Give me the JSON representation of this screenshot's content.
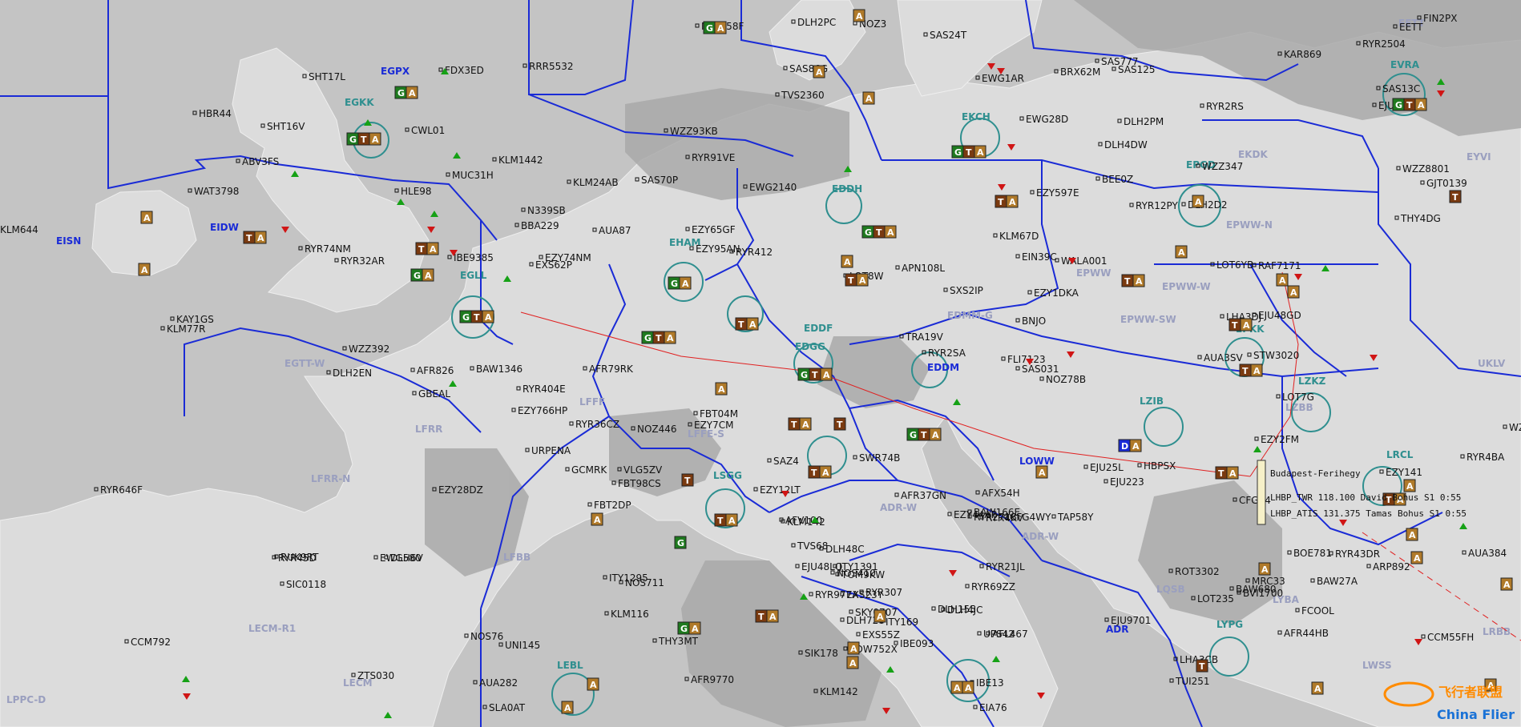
{
  "colors": {
    "sea": "#c4c4c4",
    "land": "#dcdcdc",
    "land_dark": "#a9a9a9",
    "boundary": "#1a2bd6",
    "sector": "#9a9fbf",
    "airport_ring": "#2f8f8f",
    "airport_label": "#2f8f8f",
    "fir_label": "#1a2bd6",
    "badge_green": "#1f7a1f",
    "badge_brown": "#7a3a10",
    "badge_tan": "#b07a2a",
    "arrow_up": "#16a116",
    "arrow_down": "#d01515",
    "route": "#e02020"
  },
  "fir_labels": [
    {
      "id": "EISN",
      "text": "EISN"
    },
    {
      "id": "ADR",
      "text": "ADR"
    }
  ],
  "sectors": [
    {
      "id": "EISN-text",
      "text": "EISN"
    },
    {
      "id": "egtt-w",
      "text": "EGTT-W"
    },
    {
      "id": "lfrr",
      "text": "LFRR"
    },
    {
      "id": "lfrr-n",
      "text": "LFRR-N"
    },
    {
      "id": "lfbb",
      "text": "LFBB"
    },
    {
      "id": "lecm-r1",
      "text": "LECM-R1"
    },
    {
      "id": "lecm",
      "text": "LECM"
    },
    {
      "id": "lppc-d",
      "text": "LPPC-D"
    },
    {
      "id": "lffe-n",
      "text": "LFFE-N"
    },
    {
      "id": "lffe-s",
      "text": "LFFE-S"
    },
    {
      "id": "lfff",
      "text": "LFFF"
    },
    {
      "id": "edmm-g",
      "text": "EDMM-G"
    },
    {
      "id": "epww-sw",
      "text": "EPWW-SW"
    },
    {
      "id": "epww-w",
      "text": "EPWW-W"
    },
    {
      "id": "epww-n",
      "text": "EPWW-N"
    },
    {
      "id": "epww",
      "text": "EPWW"
    },
    {
      "id": "adr-w",
      "text": "ADR-W"
    },
    {
      "id": "lqsb",
      "text": "LQSB"
    },
    {
      "id": "lyba",
      "text": "LYBA"
    },
    {
      "id": "ukbv",
      "text": "UKLV"
    },
    {
      "id": "lrbb",
      "text": "LRBB"
    },
    {
      "id": "lwss",
      "text": "LWSS"
    },
    {
      "id": "lzbb",
      "text": "LZBB"
    },
    {
      "id": "lobb",
      "text": "LOBB"
    },
    {
      "id": "ldpp",
      "text": "LDPP"
    },
    {
      "id": "edww-w",
      "text": "EDWW-W"
    },
    {
      "id": "edvv-e",
      "text": "EDVV-E"
    },
    {
      "id": "eett",
      "text": "EETT"
    },
    {
      "id": "ebbu",
      "text": "EBBU"
    },
    {
      "id": "ekdk",
      "text": "EKDK"
    },
    {
      "id": "eynk",
      "text": "EYVI"
    }
  ],
  "airports": [
    {
      "id": "egpx",
      "text": "EGPX"
    },
    {
      "id": "egkk",
      "text": "EGKK"
    },
    {
      "id": "egll",
      "text": "EGLL"
    },
    {
      "id": "eidw",
      "text": "EIDW"
    },
    {
      "id": "eham",
      "text": "EHAM"
    },
    {
      "id": "eddf",
      "text": "EDDF"
    },
    {
      "id": "eddm",
      "text": "EDDM"
    },
    {
      "id": "edgg",
      "text": "EDGG"
    },
    {
      "id": "lzib",
      "text": "LZIB"
    },
    {
      "id": "lowv",
      "text": "LOWW"
    },
    {
      "id": "epkk",
      "text": "EPKK"
    },
    {
      "id": "epgd",
      "text": "EPGD"
    },
    {
      "id": "lzkz",
      "text": "LZKZ"
    },
    {
      "id": "lrcl",
      "text": "LRCL"
    },
    {
      "id": "lssg",
      "text": "LSGG"
    },
    {
      "id": "lebl",
      "text": "LEBL"
    },
    {
      "id": "lypg",
      "text": "LYPG"
    },
    {
      "id": "evra",
      "text": "EVRA"
    },
    {
      "id": "ekch",
      "text": "EKCH"
    },
    {
      "id": "edwh",
      "text": "EDDH"
    }
  ],
  "callsigns": [
    "NPT358F",
    "DLH2PC",
    "NOZ3",
    "SAS24T",
    "FIN2PX",
    "KAR869",
    "RYR2504",
    "EETT",
    "FDX3ED",
    "RRR5532",
    "SHT17L",
    "HBR44",
    "SHT16V",
    "CWL01",
    "TVS2360",
    "SAS86G",
    "SAS125",
    "SAS777",
    "BRX62M",
    "EWG1AR",
    "EJU47PM",
    "SAS13C",
    "RYR2RS",
    "ABV3FS",
    "KLM1442",
    "WZZ93KB",
    "RYR91VE",
    "DLH2PM",
    "EWG28D",
    "MUC31H",
    "KLM24AB",
    "SAS70P",
    "DLH4DW",
    "WZZ347",
    "WZZ8801",
    "GJT0139",
    "KLM644",
    "WAT3798",
    "HLE98",
    "N339SB",
    "BEE0Z",
    "EWG2140",
    "EZY597E",
    "RYR12PY",
    "DLH2D2",
    "THY4DG",
    "BBA229",
    "AUA87",
    "EZY65GF",
    "RYR74NM",
    "RYR32AR",
    "IBE9385",
    "EZY74NM",
    "EXS62P",
    "EZY95AN",
    "RYR412",
    "KLM67D",
    "EIN39C",
    "WALA001",
    "LOT6YB",
    "RAF7171",
    "LOT8W",
    "APN108L",
    "KAY1GS",
    "SXS2IP",
    "EZY1DKA",
    "KLM77R",
    "LHA3DJ",
    "EJU48GD",
    "BNJO",
    "WZZ392",
    "DLH2EN",
    "GBEAL",
    "AFR826",
    "BAW1346",
    "RYR404E",
    "EZY766HP",
    "RYR36CZ",
    "NOZ446",
    "AFR79RK",
    "EZY7CM",
    "TRA19V",
    "RYR2SA",
    "FLI7123",
    "SAS031",
    "NOZ78B",
    "AUA3SV",
    "STW3020",
    "LOT7G",
    "EZY2FM",
    "WZZ3439",
    "RYR4BA",
    "URPENA",
    "GCMRK",
    "VLG5ZV",
    "FBT98CS",
    "SAZ4",
    "FBT04M",
    "SWR74B",
    "HBPSX",
    "EJU25L",
    "EJU223",
    "CFG84",
    "EZY141",
    "RYR646F",
    "EZY28DZ",
    "FBT2DP",
    "EZY12LT",
    "KLM142",
    "AFR37GN",
    "BAW166E",
    "AFX54H",
    "RYR4KV",
    "CFG4WY",
    "TAP58Y",
    "EZY44AP",
    "AFV100",
    "TVS68",
    "EJU48LQ",
    "ITY1391",
    "DLH48C",
    "NOS410",
    "RYR2718",
    "RUK9RT",
    "DLH6V",
    "RYR45D",
    "EWG580",
    "SIC0118",
    "ITY1295",
    "NOS711",
    "RYR977A",
    "TOM9KW",
    "EXS23Y",
    "RYR69ZZ",
    "SKY0707",
    "RYR307",
    "DLH720",
    "ITY169",
    "DLH155",
    "RYR21JL",
    "DLH4JC",
    "AFL467",
    "UPS42",
    "LOT235",
    "BAW680",
    "MRC33",
    "ROT3302",
    "BVI1700",
    "FCOOL",
    "BAW27A",
    "ARP892",
    "AUA384",
    "BOE781",
    "RYR43DR",
    "NOS76",
    "UNI145",
    "KLM116",
    "THY3MT",
    "EXS55Z",
    "IBE093",
    "EJU9701",
    "AFR44HB",
    "CCM55FH",
    "CCM792",
    "ZTS030",
    "AUA282",
    "AFR9770",
    "SIK178",
    "EDW752X",
    "LHA3CB",
    "TUI251",
    "SLA0AT",
    "KLM142",
    "IBE13",
    "EIA76"
  ],
  "atis_text": [
    "Budapest-Ferihegy",
    "LHBP_TWR 118.100 David Bohus S1 0:55",
    "LHBP_ATIS 131.375 Tamas Bohus S1 0:55"
  ],
  "watermark": {
    "cn": "飞行者联盟",
    "en": "China Flier"
  }
}
